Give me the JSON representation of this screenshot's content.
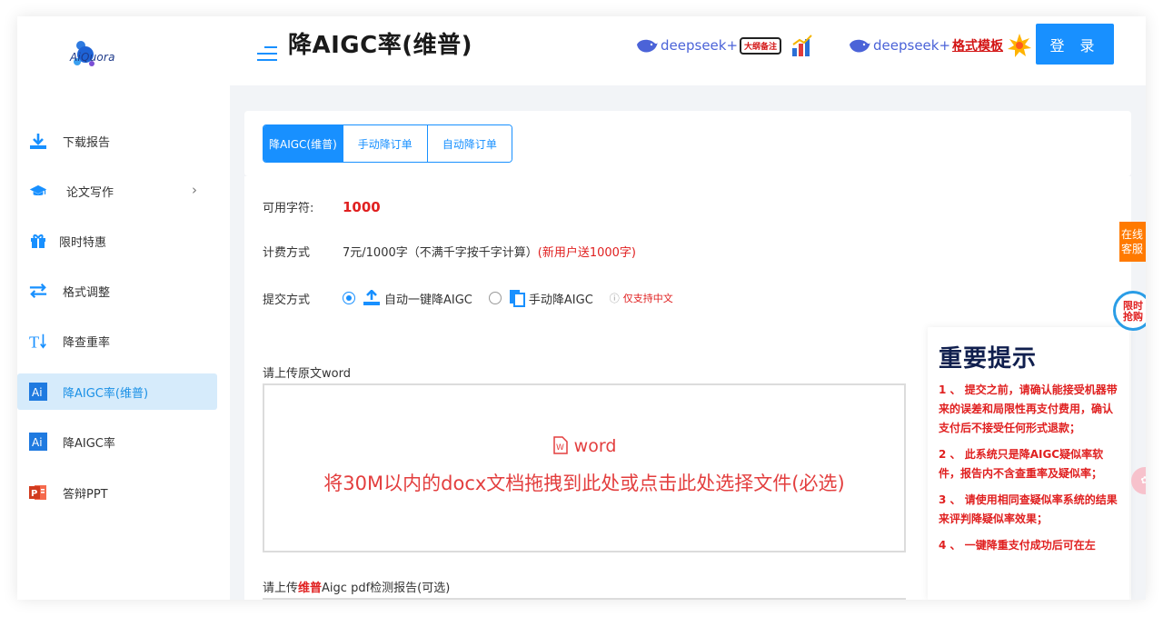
{
  "app": {
    "logo_text": "AiQuora"
  },
  "header": {
    "title": "降AIGC率(维普)",
    "promo1": {
      "brand": "deepseek+",
      "badge": "大纲备注"
    },
    "promo2": {
      "brand": "deepseek+",
      "label": "格式模板"
    },
    "login_label": "登 录"
  },
  "sidebar": {
    "items": [
      {
        "label": "下载报告",
        "icon": "download-icon"
      },
      {
        "label": "论文写作",
        "icon": "graduation-cap-icon",
        "chevron": "›"
      },
      {
        "label": "限时特惠",
        "icon": "gift-icon"
      },
      {
        "label": "格式调整",
        "icon": "swap-arrows-icon"
      },
      {
        "label": "降查重率",
        "icon": "text-size-icon"
      },
      {
        "label": "降AIGC率(维普)",
        "icon": "ai-badge-icon",
        "active": true
      },
      {
        "label": "降AIGC率",
        "icon": "ai-badge-icon"
      },
      {
        "label": "答辩PPT",
        "icon": "powerpoint-icon"
      }
    ]
  },
  "tabs": [
    {
      "label": "降AIGC(维普)",
      "active": true
    },
    {
      "label": "手动降订单"
    },
    {
      "label": "自动降订单"
    }
  ],
  "form": {
    "credits_label": "可用字符:",
    "credits_value": "1000",
    "billing_label": "计费方式",
    "billing_text": "7元/1000字（不满千字按千字计算）",
    "billing_promo": "(新用户送1000字)",
    "submit_label": "提交方式",
    "option_auto": "自动一键降AIGC",
    "option_manual": "手动降AIGC",
    "chinese_only": "仅支持中文",
    "upload_label": "请上传原文word",
    "dropzone_word": "word",
    "dropzone_text": "将30M以内的docx文档拖拽到此处或点击此处选择文件(必选)",
    "report_prefix": "请上传",
    "report_highlight": "维普",
    "report_suffix": "Aigc pdf检测报告(可选)"
  },
  "notice": {
    "title": "重要提示",
    "items": [
      "1 、 提交之前，请确认能接受机器带来的误差和局限性再支付费用，确认支付后不接受任何形式退款；",
      "2 、 此系统只是降AIGC疑似率软件，报告内不含查重率及疑似率；",
      "3 、 请使用相同查疑似率系统的结果来评判降疑似率效果；",
      "4 、 一键降重支付成功后可在左"
    ]
  },
  "floats": {
    "service": "在线客服",
    "sale": "限时抢购"
  },
  "colors": {
    "accent": "#1890ff",
    "alert": "#e02020",
    "active_bg": "#d6ebfb"
  }
}
